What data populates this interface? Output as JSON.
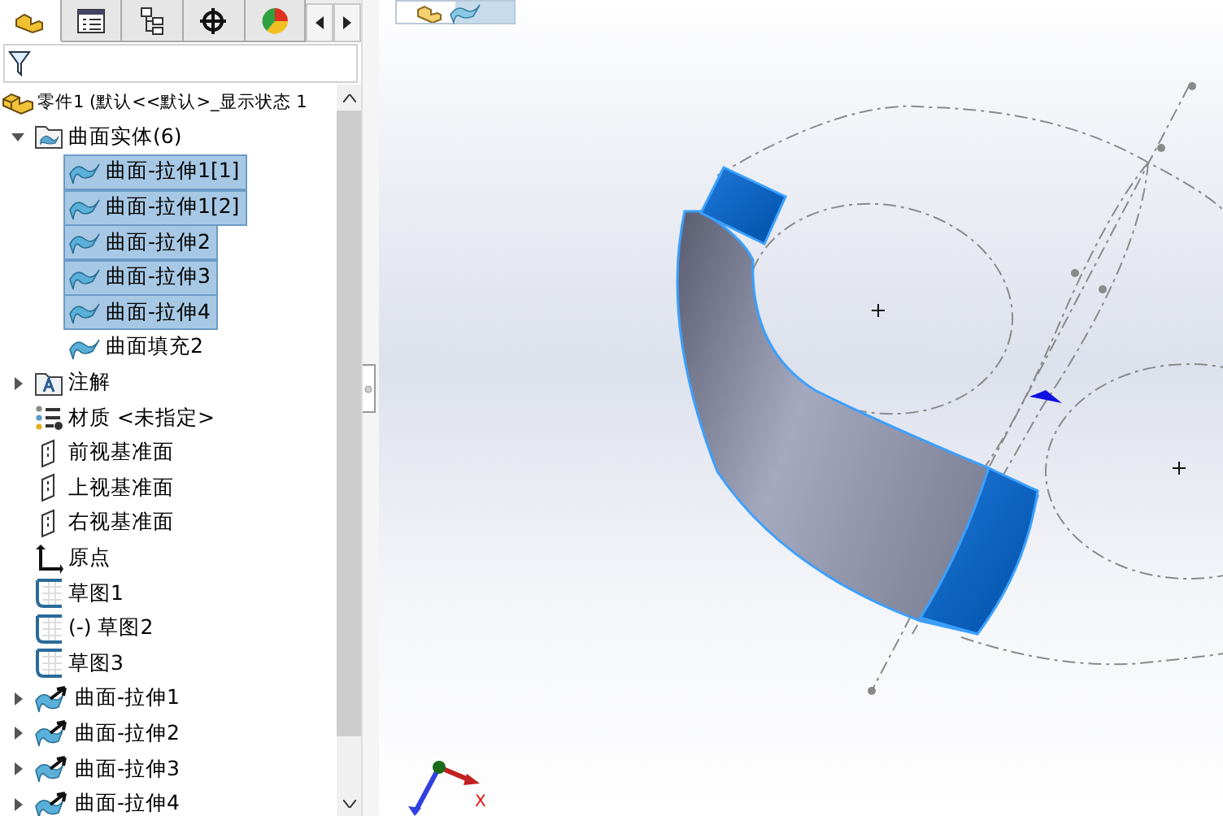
{
  "panel_tabs": [
    {
      "kind": "part",
      "selected": true
    },
    {
      "kind": "property",
      "selected": false
    },
    {
      "kind": "config",
      "selected": false
    },
    {
      "kind": "target",
      "selected": false
    },
    {
      "kind": "display",
      "selected": false
    }
  ],
  "tree": [
    {
      "label": "零件1  (默认<<默认>_显示状态 1",
      "kind": "part",
      "selected": false,
      "children": [
        {
          "label": "曲面实体(6)",
          "kind": "folder",
          "expanded": true,
          "selected": false,
          "children": [
            {
              "label": "曲面-拉伸1[1]",
              "kind": "surface",
              "selected": true
            },
            {
              "label": "曲面-拉伸1[2]",
              "kind": "surface",
              "selected": true
            },
            {
              "label": "曲面-拉伸2",
              "kind": "surface",
              "selected": true
            },
            {
              "label": "曲面-拉伸3",
              "kind": "surface",
              "selected": true
            },
            {
              "label": "曲面-拉伸4",
              "kind": "surface",
              "selected": true
            },
            {
              "label": "曲面填充2",
              "kind": "surface",
              "selected": false
            }
          ]
        },
        {
          "label": "注解",
          "kind": "annotation",
          "expanded": false,
          "selected": false
        },
        {
          "label": "材质 <未指定>",
          "kind": "material",
          "selected": false
        },
        {
          "label": "前视基准面",
          "kind": "plane",
          "selected": false
        },
        {
          "label": "上视基准面",
          "kind": "plane",
          "selected": false
        },
        {
          "label": "右视基准面",
          "kind": "plane",
          "selected": false
        },
        {
          "label": "原点",
          "kind": "origin",
          "selected": false
        },
        {
          "label": "草图1",
          "kind": "sketch",
          "selected": false
        },
        {
          "label": "(-) 草图2",
          "kind": "sketch",
          "selected": false
        },
        {
          "label": "草图3",
          "kind": "sketch",
          "selected": false
        },
        {
          "label": "曲面-拉伸1",
          "kind": "extrude",
          "expanded": false,
          "selected": false
        },
        {
          "label": "曲面-拉伸2",
          "kind": "extrude",
          "expanded": false,
          "selected": false
        },
        {
          "label": "曲面-拉伸3",
          "kind": "extrude",
          "expanded": false,
          "selected": false
        },
        {
          "label": "曲面-拉伸4",
          "kind": "extrude",
          "expanded": false,
          "selected": false
        }
      ]
    }
  ],
  "viewport": {
    "triad_label": "X"
  }
}
